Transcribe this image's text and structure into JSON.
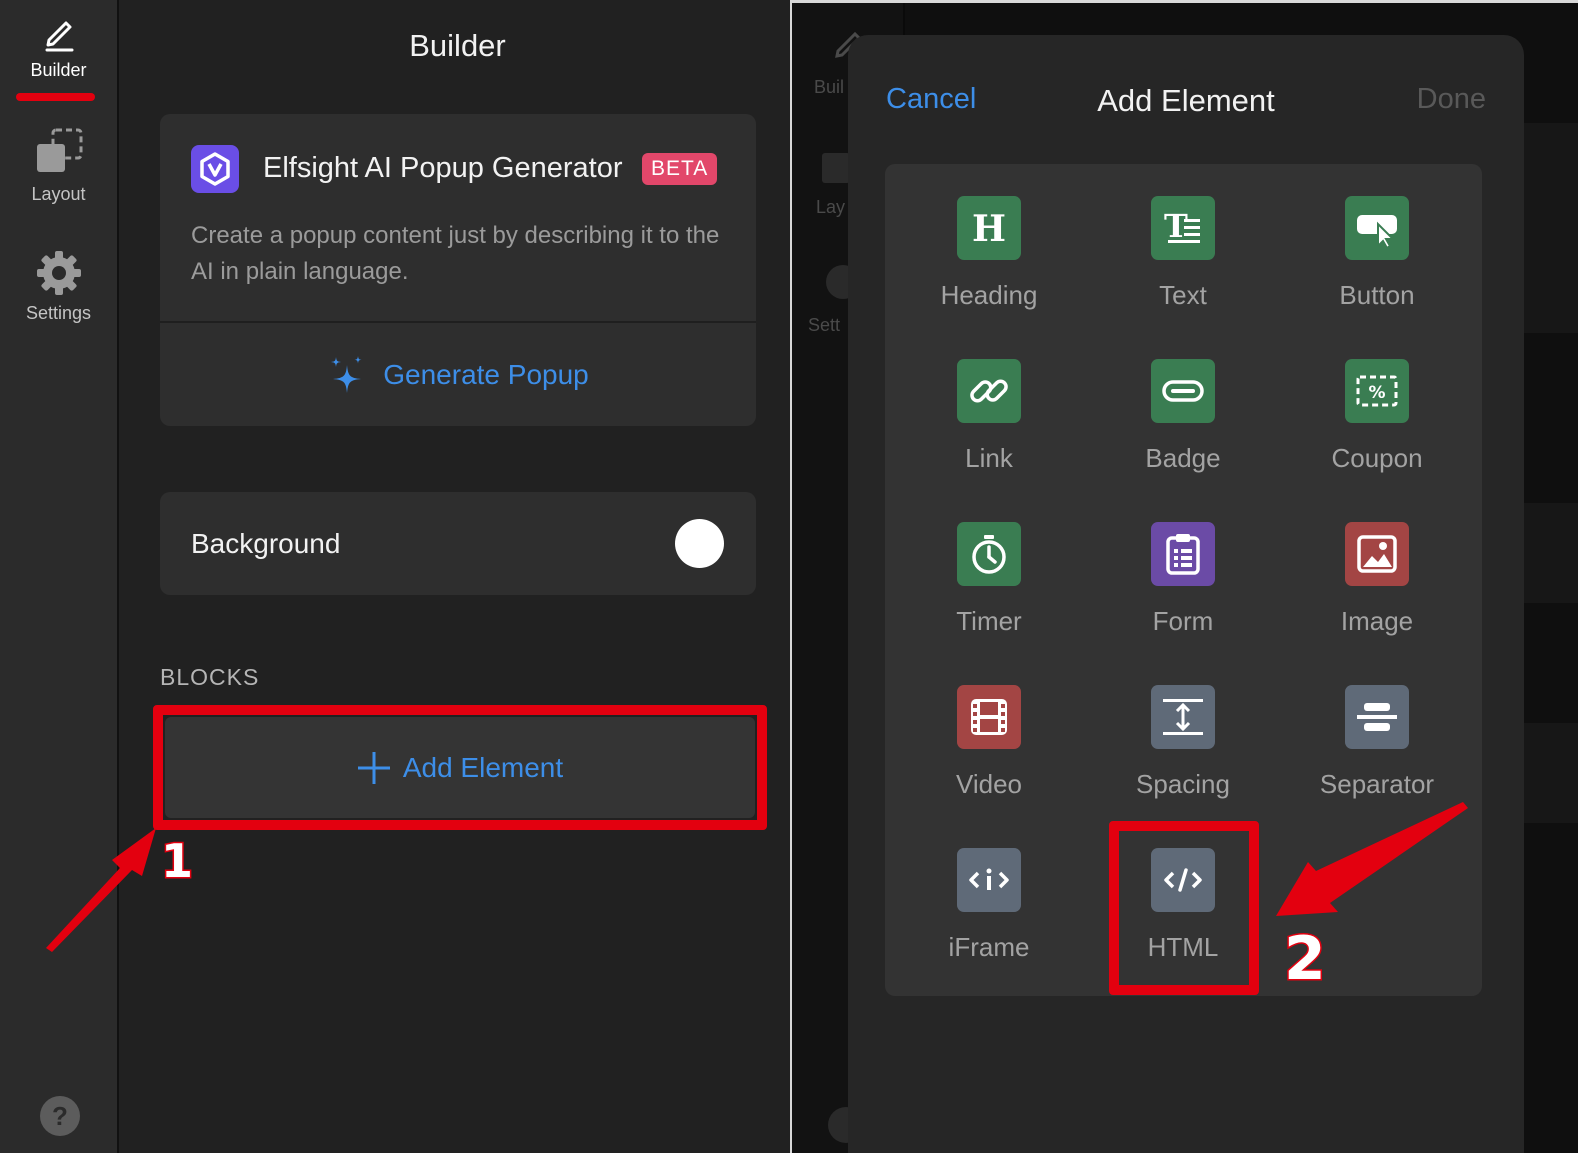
{
  "left": {
    "rail": {
      "items": [
        {
          "label": "Builder",
          "icon": "pencil-icon",
          "active": true
        },
        {
          "label": "Layout",
          "icon": "layout-icon",
          "active": false
        },
        {
          "label": "Settings",
          "icon": "gear-icon",
          "active": false
        }
      ],
      "help_label": "?"
    },
    "title": "Builder",
    "ai_card": {
      "title": "Elfsight AI Popup Generator",
      "badge": "BETA",
      "description": "Create a popup content just by describing it to the AI in plain language.",
      "button": "Generate Popup",
      "button_icon": "sparkles-icon"
    },
    "background": {
      "label": "Background",
      "toggle_on": true
    },
    "blocks_label": "BLOCKS",
    "add_button": "Add Element",
    "step_label": "1"
  },
  "right": {
    "rail_ghost": {
      "builder": "Buil",
      "layout": "Lay",
      "settings": "Sett"
    },
    "modal": {
      "cancel": "Cancel",
      "title": "Add Element",
      "done": "Done",
      "elements": [
        {
          "label": "Heading",
          "icon": "heading-icon",
          "color": "#3a7d52"
        },
        {
          "label": "Text",
          "icon": "text-icon",
          "color": "#3a7d52"
        },
        {
          "label": "Button",
          "icon": "button-cursor-icon",
          "color": "#3a7d52"
        },
        {
          "label": "Link",
          "icon": "link-icon",
          "color": "#3a7d52"
        },
        {
          "label": "Badge",
          "icon": "badge-icon",
          "color": "#3a7d52"
        },
        {
          "label": "Coupon",
          "icon": "coupon-icon",
          "color": "#3a7d52"
        },
        {
          "label": "Timer",
          "icon": "stopwatch-icon",
          "color": "#3a7d52"
        },
        {
          "label": "Form",
          "icon": "clipboard-icon",
          "color": "#6b4ba6"
        },
        {
          "label": "Image",
          "icon": "image-icon",
          "color": "#a34544"
        },
        {
          "label": "Video",
          "icon": "film-icon",
          "color": "#a34544"
        },
        {
          "label": "Spacing",
          "icon": "spacing-icon",
          "color": "#5f6a78"
        },
        {
          "label": "Separator",
          "icon": "separator-icon",
          "color": "#5f6a78"
        },
        {
          "label": "iFrame",
          "icon": "iframe-icon",
          "color": "#5f6a78"
        },
        {
          "label": "HTML",
          "icon": "code-icon",
          "color": "#5f6a78"
        }
      ]
    },
    "step_label": "2"
  },
  "annotation_color": "#e3000f"
}
